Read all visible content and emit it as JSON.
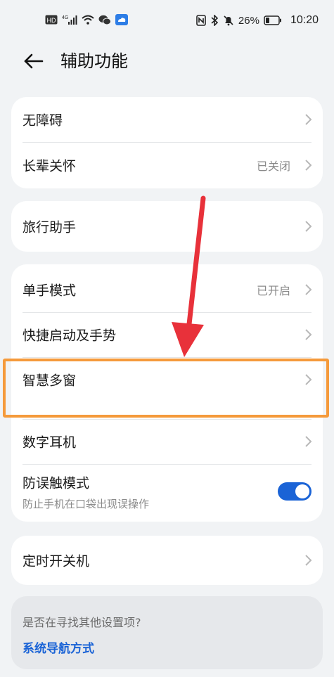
{
  "status_bar": {
    "left_icons": [
      "hd-icon",
      "signal-4g-icon",
      "wifi-icon",
      "wechat-icon",
      "cloud-icon"
    ],
    "right_icons": [
      "nfc-icon",
      "bluetooth-icon",
      "mute-icon"
    ],
    "hd_label": "HD",
    "network_label": "4G",
    "battery": "26%",
    "time": "10:20"
  },
  "header": {
    "back_icon": "back-arrow-icon",
    "title": "辅助功能"
  },
  "cards": {
    "group1": {
      "items": [
        {
          "label": "无障碍",
          "status": ""
        },
        {
          "label": "长辈关怀",
          "status": "已关闭"
        }
      ]
    },
    "group2": {
      "items": [
        {
          "label": "旅行助手",
          "status": ""
        }
      ]
    },
    "group3": {
      "items": [
        {
          "label": "单手模式",
          "status": "已开启"
        },
        {
          "label": "快捷启动及手势",
          "status": ""
        },
        {
          "label": "智慧多窗",
          "status": ""
        },
        {
          "label": "数字耳机",
          "status": ""
        }
      ],
      "toggle_item": {
        "label": "防误触模式",
        "sublabel": "防止手机在口袋出现误操作",
        "enabled": true
      }
    },
    "group4": {
      "items": [
        {
          "label": "定时开关机",
          "status": ""
        }
      ]
    }
  },
  "suggestion": {
    "question": "是否在寻找其他设置项?",
    "link": "系统导航方式"
  },
  "colors": {
    "accent": "#1a63d6",
    "highlight": "#f59a3b",
    "annotation_arrow": "#e8313a",
    "background": "#f1f3f5"
  }
}
